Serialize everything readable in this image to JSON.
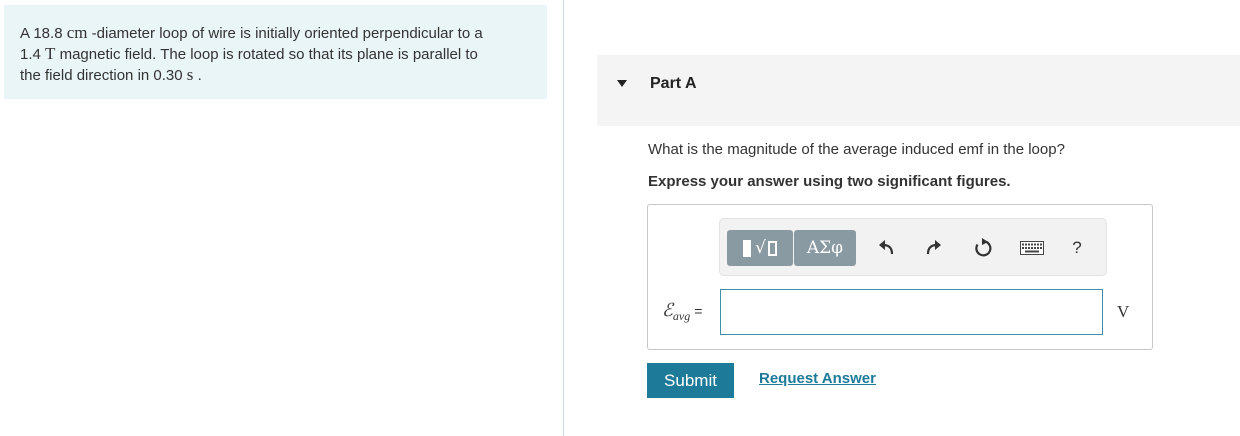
{
  "problem": {
    "line1_pre": "A 18.8 ",
    "line1_unit": "cm",
    "line1_post": " -diameter loop of wire is initially oriented perpendicular to a",
    "line2_pre": "1.4 ",
    "line2_unit": "T",
    "line2_post": " magnetic field. The loop is rotated so that its plane is parallel to",
    "line3_pre": "the field direction in 0.30 ",
    "line3_unit": "s",
    "line3_post": " ."
  },
  "part": {
    "title": "Part A",
    "question": "What is the magnitude of the average induced emf in the loop?",
    "instruction": "Express your answer using two significant figures."
  },
  "toolbar": {
    "templates_icon": "templates-icon",
    "symbols_label": "ΑΣφ",
    "undo_icon": "undo-icon",
    "redo_icon": "redo-icon",
    "reset_icon": "reset-icon",
    "keyboard_icon": "keyboard-icon",
    "help_label": "?"
  },
  "answer": {
    "var_symbol": "ℰ",
    "var_subscript": "avg",
    "equals": "=",
    "value": "",
    "unit": "V"
  },
  "actions": {
    "submit_label": "Submit",
    "request_label": "Request Answer"
  },
  "colors": {
    "accent": "#1d7a99",
    "problem_bg": "#e9f5f7",
    "toolbar_btn": "#8a9aa3"
  }
}
